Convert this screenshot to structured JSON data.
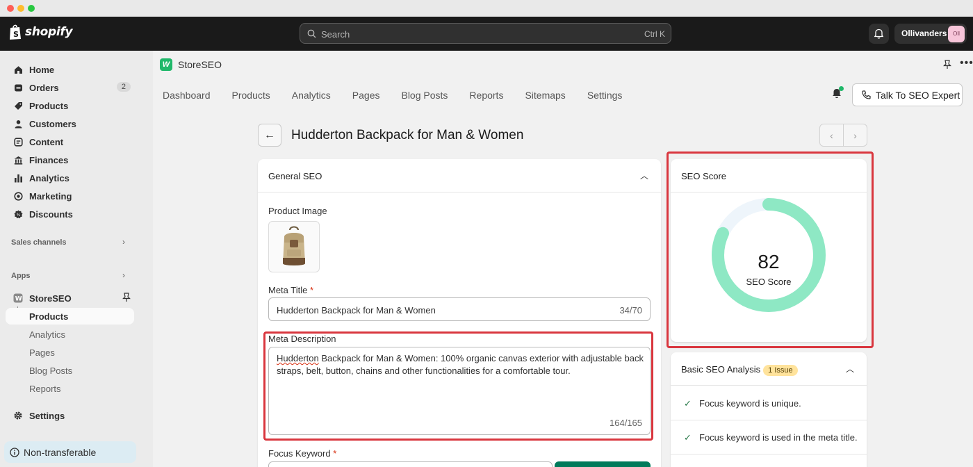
{
  "topbar": {
    "brand": "shopify",
    "search_placeholder": "Search",
    "search_shortcut": "Ctrl K",
    "store_name": "Ollivanders",
    "store_initials": "Oll"
  },
  "sidebar": {
    "items": [
      {
        "label": "Home",
        "icon": "home-icon"
      },
      {
        "label": "Orders",
        "icon": "orders-icon",
        "badge": "2"
      },
      {
        "label": "Products",
        "icon": "tag-icon"
      },
      {
        "label": "Customers",
        "icon": "person-icon"
      },
      {
        "label": "Content",
        "icon": "content-icon"
      },
      {
        "label": "Finances",
        "icon": "bank-icon"
      },
      {
        "label": "Analytics",
        "icon": "bar-chart-icon"
      },
      {
        "label": "Marketing",
        "icon": "target-icon"
      },
      {
        "label": "Discounts",
        "icon": "discount-icon"
      }
    ],
    "sales_channels": "Sales channels",
    "apps": "Apps",
    "app_name": "StoreSEO",
    "app_subitems": [
      "Products",
      "Analytics",
      "Pages",
      "Blog Posts",
      "Reports"
    ],
    "settings": "Settings",
    "non_transferable": "Non-transferable"
  },
  "app": {
    "name": "StoreSEO",
    "logo_glyph": "W",
    "tabs": [
      "Dashboard",
      "Products",
      "Analytics",
      "Pages",
      "Blog Posts",
      "Reports",
      "Sitemaps",
      "Settings"
    ],
    "expert_button": "Talk To SEO Expert"
  },
  "product": {
    "title": "Hudderton Backpack for Man & Women"
  },
  "general_seo": {
    "heading": "General SEO",
    "product_image_label": "Product Image",
    "meta_title_label": "Meta Title",
    "meta_title_value": "Hudderton Backpack for Man & Women",
    "meta_title_count": "34/70",
    "meta_description_label": "Meta Description",
    "meta_description_first_word": "Hudderton",
    "meta_description_rest": " Backpack for Man & Women: 100% organic canvas exterior with adjustable back straps, belt, button, chains and other functionalities for a comfortable tour.",
    "meta_description_count": "164/165",
    "focus_keyword_label": "Focus Keyword",
    "required_mark": "*"
  },
  "seo_score": {
    "heading": "SEO Score",
    "value": 82,
    "label": "SEO Score",
    "color": "#8ee8c4",
    "track_color": "#eef5fb"
  },
  "basic_analysis": {
    "heading": "Basic SEO Analysis",
    "issue_badge": "1 Issue",
    "checks": [
      "Focus keyword is unique.",
      "Focus keyword is used in the meta title."
    ]
  }
}
